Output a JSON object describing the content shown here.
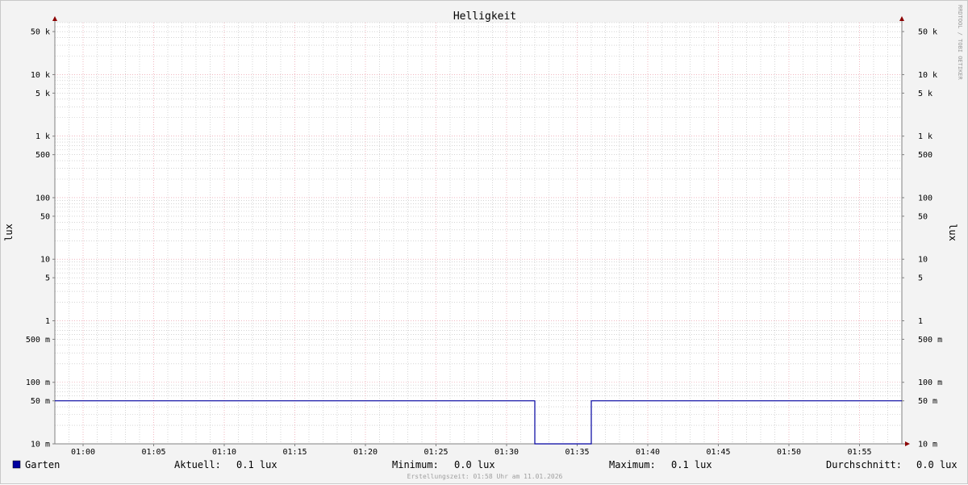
{
  "chart_data": {
    "type": "line",
    "title": "Helligkeit",
    "ylabel": "lux",
    "ylabel_right": "lux",
    "y_scale": "log",
    "ylim": [
      0.01,
      70000
    ],
    "y_ticks": [
      {
        "value": 50000,
        "label": "50 k"
      },
      {
        "value": 10000,
        "label": "10 k"
      },
      {
        "value": 5000,
        "label": "5 k"
      },
      {
        "value": 1000,
        "label": "1 k"
      },
      {
        "value": 500,
        "label": "500"
      },
      {
        "value": 100,
        "label": "100"
      },
      {
        "value": 50,
        "label": "50"
      },
      {
        "value": 10,
        "label": "10"
      },
      {
        "value": 5,
        "label": "5"
      },
      {
        "value": 1,
        "label": "1"
      },
      {
        "value": 0.5,
        "label": "500 m"
      },
      {
        "value": 0.1,
        "label": "100 m"
      },
      {
        "value": 0.05,
        "label": "50 m"
      },
      {
        "value": 0.01,
        "label": "10 m"
      }
    ],
    "x_ticks": [
      "01:00",
      "01:05",
      "01:10",
      "01:15",
      "01:20",
      "01:25",
      "01:30",
      "01:35",
      "01:40",
      "01:45",
      "01:50",
      "01:55"
    ],
    "xlim": [
      "00:58",
      "01:58"
    ],
    "grid": true,
    "series": [
      {
        "name": "Garten",
        "color": "#0000a0",
        "x": [
          "00:58",
          "01:32",
          "01:32",
          "01:36",
          "01:36",
          "01:58"
        ],
        "y": [
          0.05,
          0.05,
          0.01,
          0.01,
          0.05,
          0.05
        ]
      }
    ],
    "legend": {
      "swatch_color": "#0000a0",
      "name": "Garten",
      "stats": [
        {
          "label": "Aktuell:",
          "value": "0.1 lux"
        },
        {
          "label": "Minimum:",
          "value": "0.0 lux"
        },
        {
          "label": "Maximum:",
          "value": "0.1 lux"
        },
        {
          "label": "Durchschnitt:",
          "value": "0.0 lux"
        }
      ]
    },
    "watermark": "RRDTOOL / TOBI OETIKER",
    "footer": "Erstellungszeit: 01:58 Uhr am 11.01.2026",
    "colors": {
      "background": "#f3f3f3",
      "plot_background": "#ffffff",
      "major_grid": "#e88a9a",
      "minor_grid": "#bcbcbc",
      "axis": "#808080",
      "arrow": "#8b0000"
    }
  }
}
